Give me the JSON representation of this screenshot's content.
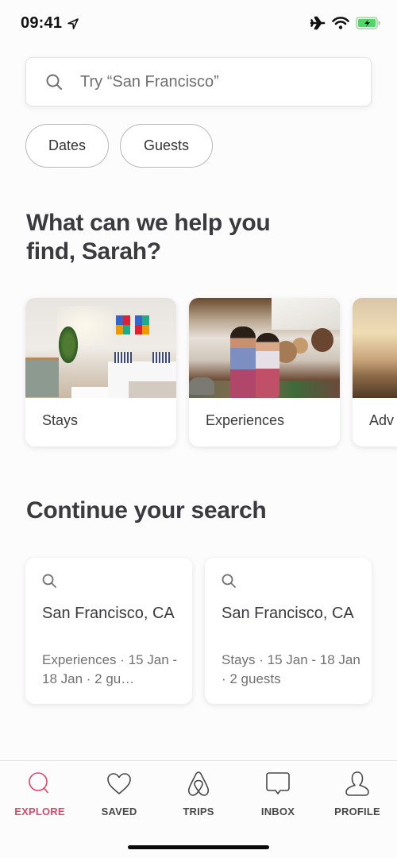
{
  "status_bar": {
    "time": "09:41",
    "icons": [
      "location-arrow-icon",
      "airplane-icon",
      "wifi-icon",
      "battery-charging-icon"
    ],
    "battery_color": "#4cd964"
  },
  "search": {
    "placeholder": "Try “San Francisco”",
    "value": "",
    "icon": "search-icon"
  },
  "filters": [
    {
      "label": "Dates"
    },
    {
      "label": "Guests"
    }
  ],
  "greeting_heading": "What can we help you find, Sarah?",
  "categories": [
    {
      "label": "Stays",
      "image": "bedroom-photo"
    },
    {
      "label": "Experiences",
      "image": "cooking-class-photo"
    },
    {
      "label": "Adv",
      "image": "sunset-landscape-photo"
    }
  ],
  "continue_heading": "Continue your search",
  "recent_searches": [
    {
      "title": "San Francisco, CA",
      "subtitle": "Experiences · 15 Jan - 18 Jan · 2 gu…"
    },
    {
      "title": "San Francisco, CA",
      "subtitle": "Stays · 15 Jan - 18 Jan · 2 guests"
    }
  ],
  "tab_bar": {
    "accent_color": "#e0466a",
    "tabs": [
      {
        "label": "EXPLORE",
        "icon": "search-icon",
        "active": true
      },
      {
        "label": "SAVED",
        "icon": "heart-icon",
        "active": false
      },
      {
        "label": "TRIPS",
        "icon": "airbnb-logo-icon",
        "active": false
      },
      {
        "label": "INBOX",
        "icon": "message-bubble-icon",
        "active": false
      },
      {
        "label": "PROFILE",
        "icon": "person-icon",
        "active": false
      }
    ]
  }
}
